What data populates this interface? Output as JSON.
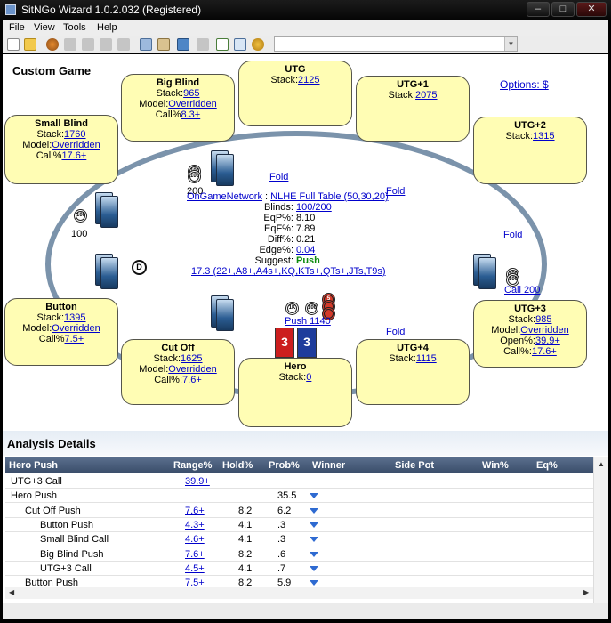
{
  "window": {
    "title": "SitNGo Wizard 1.0.2.032 (Registered)"
  },
  "menu": [
    "File",
    "View",
    "Tools",
    "Help"
  ],
  "custom_title": "Custom Game",
  "options_link": "Options: $",
  "seats": {
    "utg": {
      "name": "UTG",
      "stack_label": "Stack:",
      "stack": "2125"
    },
    "utg1": {
      "name": "UTG+1",
      "stack_label": "Stack:",
      "stack": "2075"
    },
    "utg2": {
      "name": "UTG+2",
      "stack_label": "Stack:",
      "stack": "1315"
    },
    "utg3": {
      "name": "UTG+3",
      "stack_label": "Stack:",
      "stack": "985",
      "model_label": "Model:",
      "model": "Overridden",
      "open_label": "Open%:",
      "open": "39.9+",
      "call_label": "Call%:",
      "call": "17.6+"
    },
    "utg4": {
      "name": "UTG+4",
      "stack_label": "Stack:",
      "stack": "1115"
    },
    "hero": {
      "name": "Hero",
      "stack_label": "Stack:",
      "stack": "0"
    },
    "cutoff": {
      "name": "Cut Off",
      "stack_label": "Stack:",
      "stack": "1625",
      "model_label": "Model:",
      "model": "Overridden",
      "call_label": "Call%:",
      "call": "7.6+"
    },
    "button": {
      "name": "Button",
      "stack_label": "Stack:",
      "stack": "1395",
      "model_label": "Model:",
      "model": "Overridden",
      "call_label": "Call%",
      "call": "7.5+"
    },
    "small_blind": {
      "name": "Small Blind",
      "stack_label": "Stack:",
      "stack": "1760",
      "model_label": "Model:",
      "model": "Overridden",
      "call_label": "Call%",
      "call": "17.6+"
    },
    "big_blind": {
      "name": "Big Blind",
      "stack_label": "Stack:",
      "stack": "965",
      "model_label": "Model:",
      "model": "Overridden",
      "call_label": "Call%",
      "call": "8.3+"
    }
  },
  "actions": {
    "bb_fold": "Fold",
    "utg_fold": "Fold",
    "utg2_fold": "Fold",
    "utg3_call": "Call 200",
    "utg4_fold": "Fold",
    "hero_push": "Push 1140"
  },
  "bets": {
    "big_blind": "200",
    "small_blind": "100"
  },
  "chip_labels": {
    "c100": "100",
    "c1k": "1K",
    "c5": "5"
  },
  "dealer_label": "D",
  "hero_cards": [
    {
      "rank": "3",
      "color": "#cc1e1e"
    },
    {
      "rank": "3",
      "color": "#1e3c9c"
    }
  ],
  "info": {
    "network": "OnGameNetwork",
    "sep": " : ",
    "table": "NLHE Full Table (50,30,20)",
    "blinds_label": "Blinds:",
    "blinds": "100/200",
    "eqp_label": "EqP%:",
    "eqp": "8.10",
    "eqf_label": "EqF%:",
    "eqf": "7.89",
    "diff_label": "Diff%:",
    "diff": "0.21",
    "edge_label": "Edge%:",
    "edge": "0.04",
    "suggest_label": "Suggest:",
    "suggest": "Push",
    "range": "17.3 (22+,A8+,A4s+,KQ,KTs+,QTs+,JTs,T9s)"
  },
  "analysis": {
    "title": "Analysis Details",
    "columns": [
      "Hero Push",
      "Range%",
      "Hold%",
      "Prob%",
      "Winner",
      "Side Pot",
      "Win%",
      "Eq%"
    ],
    "rows": [
      {
        "label": "UTG+3 Call",
        "range": "39.9+",
        "hold": "",
        "prob": "",
        "indent": 0,
        "arrow": false
      },
      {
        "label": "Hero Push",
        "range": "",
        "hold": "",
        "prob": "35.5",
        "indent": 0,
        "arrow": true
      },
      {
        "label": "Cut Off Push",
        "range": "7.6+",
        "hold": "8.2",
        "prob": "6.2",
        "indent": 1,
        "arrow": true
      },
      {
        "label": "Button Push",
        "range": "4.3+",
        "hold": "4.1",
        "prob": ".3",
        "indent": 2,
        "arrow": true
      },
      {
        "label": "Small Blind Call",
        "range": "4.6+",
        "hold": "4.1",
        "prob": ".3",
        "indent": 2,
        "arrow": true
      },
      {
        "label": "Big Blind Push",
        "range": "7.6+",
        "hold": "8.2",
        "prob": ".6",
        "indent": 2,
        "arrow": true
      },
      {
        "label": "UTG+3 Call",
        "range": "4.5+",
        "hold": "4.1",
        "prob": ".7",
        "indent": 2,
        "arrow": true
      },
      {
        "label": "Button Push",
        "range": "7.5+",
        "hold": "8.2",
        "prob": "5.9",
        "indent": 1,
        "arrow": true
      }
    ]
  }
}
